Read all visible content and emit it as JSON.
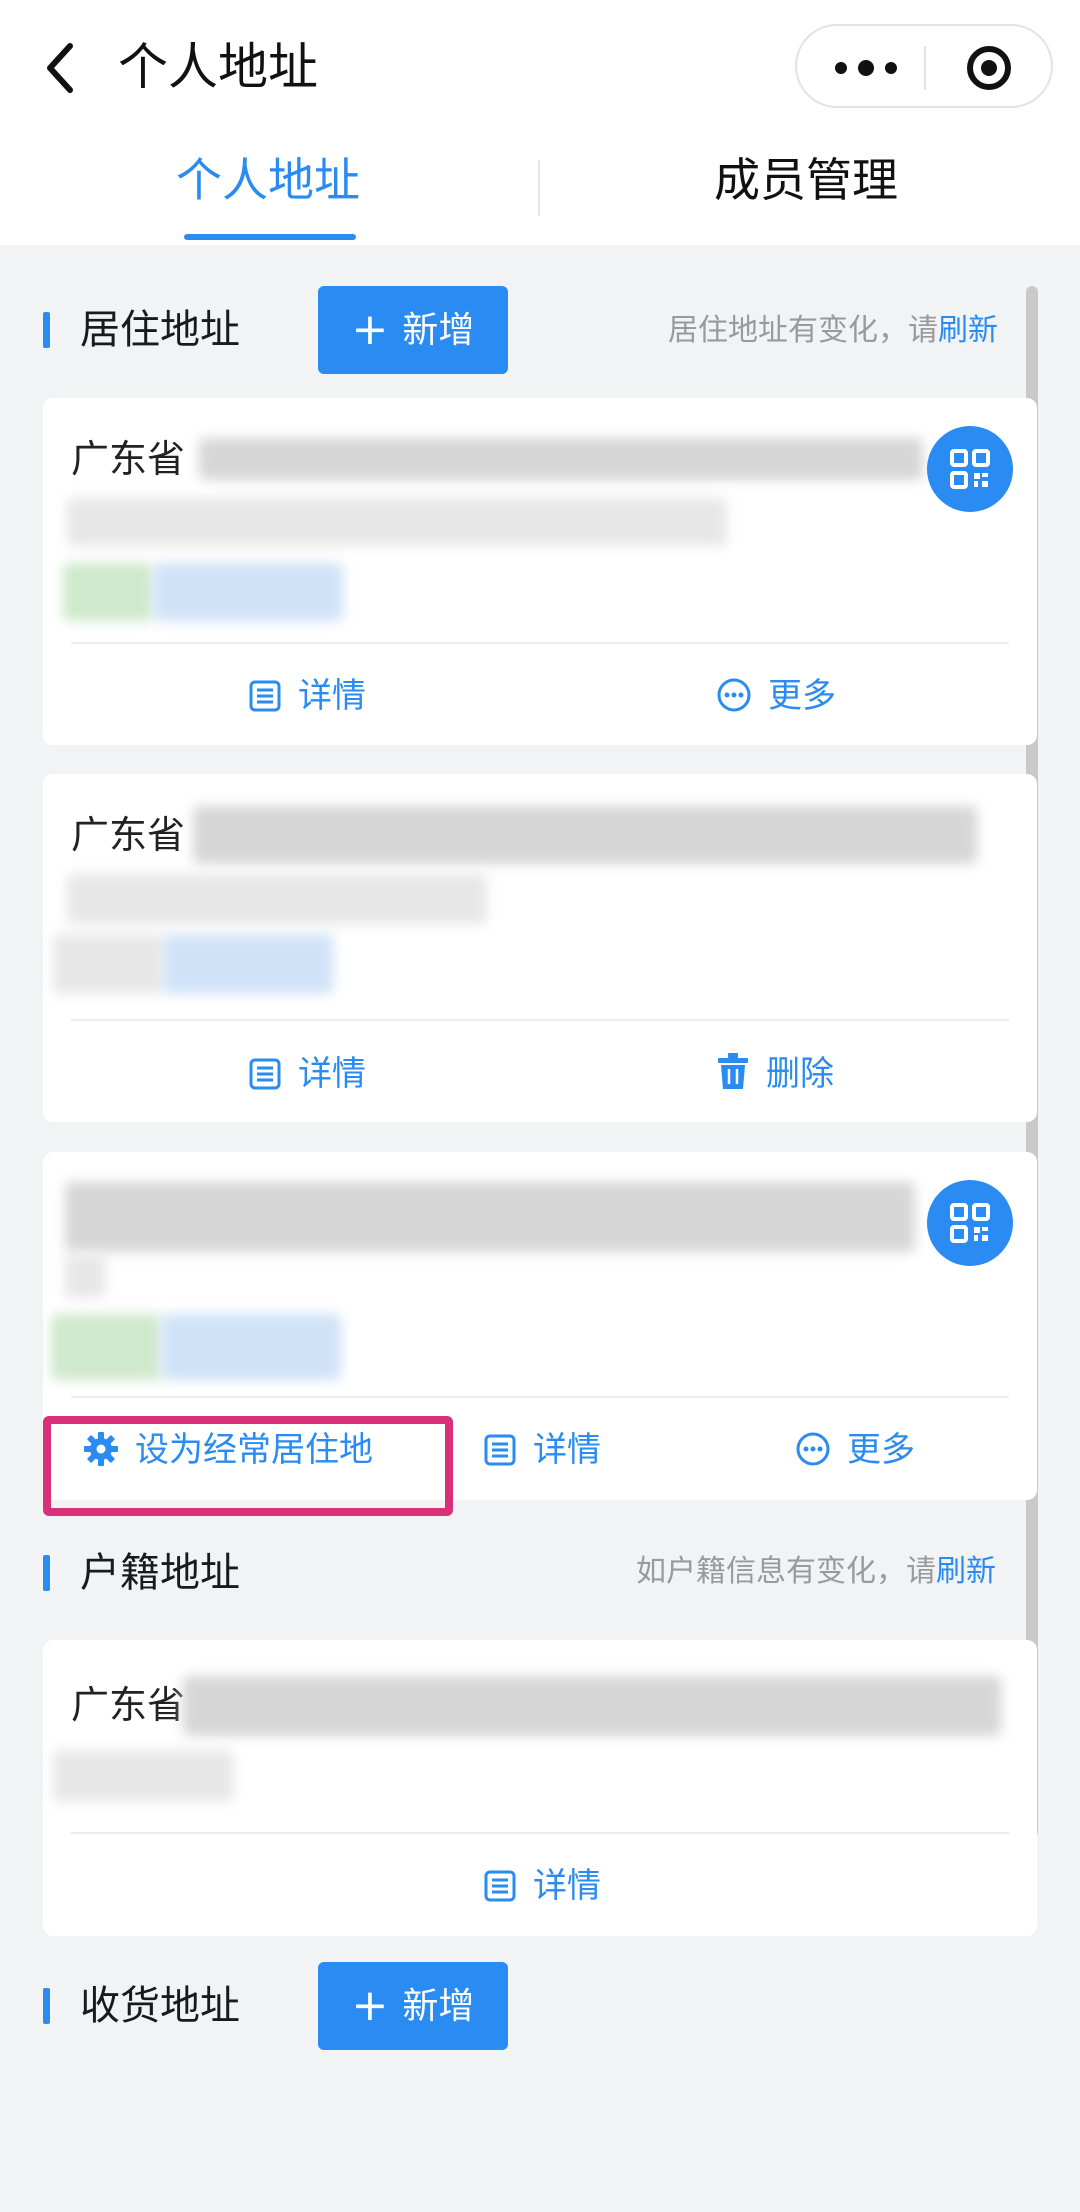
{
  "header": {
    "title": "个人地址",
    "tabs": [
      {
        "label": "个人地址",
        "active": true
      },
      {
        "label": "成员管理",
        "active": false
      }
    ]
  },
  "residence": {
    "title": "居住地址",
    "add_label": "新增",
    "hint_text": "居住地址有变化，请",
    "hint_link": "刷新",
    "cards": [
      {
        "prefix": "广东省",
        "actions": [
          "详情",
          "更多"
        ]
      },
      {
        "prefix": "广东省",
        "actions": [
          "详情",
          "删除"
        ]
      },
      {
        "prefix": "",
        "actions": [
          "设为经常居住地",
          "详情",
          "更多"
        ]
      }
    ]
  },
  "household": {
    "title": "户籍地址",
    "hint_text": "如户籍信息有变化，请",
    "hint_link": "刷新",
    "card": {
      "prefix": "广东省",
      "actions": [
        "详情"
      ]
    }
  },
  "shipping": {
    "title": "收货地址",
    "add_label": "新增"
  },
  "colors": {
    "accent": "#2a8bf2",
    "highlight": "#d9307a",
    "background": "#f2f3f5"
  }
}
